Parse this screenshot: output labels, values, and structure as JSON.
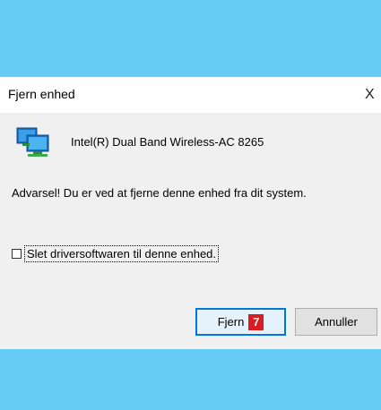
{
  "dialog": {
    "title": "Fjern enhed",
    "close_glyph": "X",
    "device_icon": "network-adapter-icon",
    "device_name": "Intel(R) Dual Band Wireless-AC 8265",
    "warning": "Advarsel! Du er ved at fjerne denne enhed fra dit system.",
    "checkbox_label": "Slet driversoftwaren til denne enhed.",
    "checkbox_checked": false,
    "ok_label": "Fjern",
    "ok_badge": "7",
    "cancel_label": "Annuller"
  },
  "colors": {
    "background": "#67cdf4",
    "badge": "#d81e22",
    "focus_border": "#0078d7"
  }
}
